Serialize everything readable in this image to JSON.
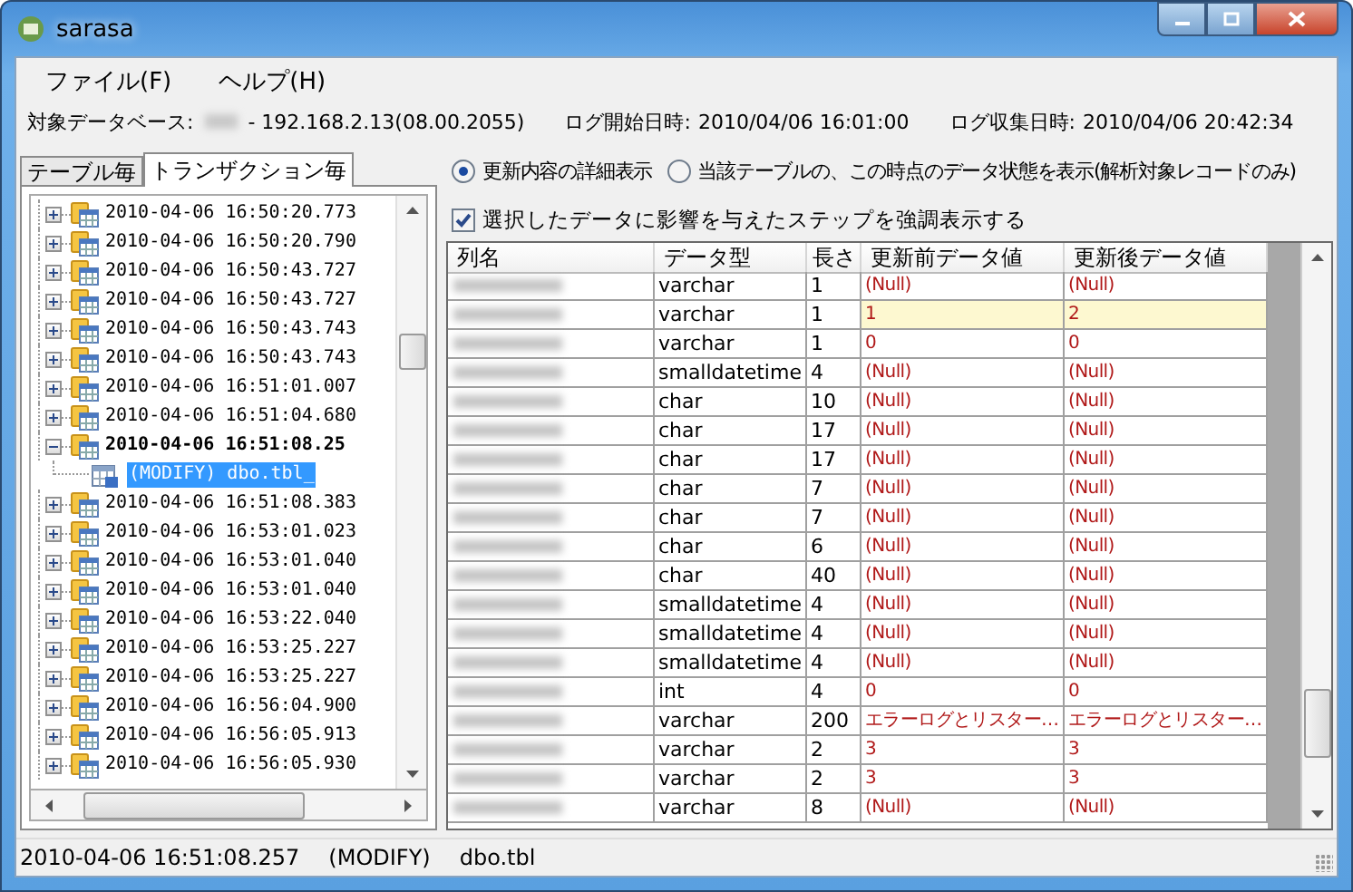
{
  "window": {
    "title": "sarasa"
  },
  "menu": [
    "ファイル(F)",
    "ヘルプ(H)"
  ],
  "info": {
    "db_label": "対象データベース:",
    "db_value": "- 192.168.2.13(08.00.2055)",
    "start_label": "ログ開始日時:",
    "start_value": "2010/04/06 16:01:00",
    "collect_label": "ログ収集日時:",
    "collect_value": "2010/04/06 20:42:34"
  },
  "tabs": [
    {
      "label": "テーブル毎",
      "selected": false
    },
    {
      "label": "トランザクション毎",
      "selected": true
    }
  ],
  "tree": [
    {
      "label": "2010-04-06 16:50:20.773",
      "expanded": false
    },
    {
      "label": "2010-04-06 16:50:20.790",
      "expanded": false
    },
    {
      "label": "2010-04-06 16:50:43.727",
      "expanded": false
    },
    {
      "label": "2010-04-06 16:50:43.727",
      "expanded": false
    },
    {
      "label": "2010-04-06 16:50:43.743",
      "expanded": false
    },
    {
      "label": "2010-04-06 16:50:43.743",
      "expanded": false
    },
    {
      "label": "2010-04-06 16:51:01.007",
      "expanded": false
    },
    {
      "label": "2010-04-06 16:51:04.680",
      "expanded": false
    },
    {
      "label": "2010-04-06 16:51:08.25",
      "expanded": true,
      "children": [
        {
          "label": "(MODIFY)   dbo.tbl_",
          "selected": true
        }
      ]
    },
    {
      "label": "2010-04-06 16:51:08.383",
      "expanded": false
    },
    {
      "label": "2010-04-06 16:53:01.023",
      "expanded": false
    },
    {
      "label": "2010-04-06 16:53:01.040",
      "expanded": false
    },
    {
      "label": "2010-04-06 16:53:01.040",
      "expanded": false
    },
    {
      "label": "2010-04-06 16:53:22.040",
      "expanded": false
    },
    {
      "label": "2010-04-06 16:53:25.227",
      "expanded": false
    },
    {
      "label": "2010-04-06 16:53:25.227",
      "expanded": false
    },
    {
      "label": "2010-04-06 16:56:04.900",
      "expanded": false
    },
    {
      "label": "2010-04-06 16:56:05.913",
      "expanded": false
    },
    {
      "label": "2010-04-06 16:56:05.930",
      "expanded": false
    }
  ],
  "view_options": [
    {
      "label": "更新内容の詳細表示",
      "selected": true
    },
    {
      "label": "当該テーブルの、この時点のデータ状態を表示(解析対象レコードのみ)",
      "selected": false
    }
  ],
  "highlight_option": {
    "label": "選択したデータに影響を与えたステップを強調表示する",
    "checked": true
  },
  "table": {
    "columns": [
      "列名",
      "データ型",
      "長さ",
      "更新前データ値",
      "更新後データ値"
    ],
    "rows": [
      {
        "type": "varchar",
        "length": "1",
        "before": "(Null)",
        "after": "(Null)",
        "highlighted": false
      },
      {
        "type": "varchar",
        "length": "1",
        "before": "1",
        "after": "2",
        "highlighted": true
      },
      {
        "type": "varchar",
        "length": "1",
        "before": "0",
        "after": "0",
        "highlighted": false
      },
      {
        "type": "smalldatetime",
        "length": "4",
        "before": "(Null)",
        "after": "(Null)",
        "highlighted": false
      },
      {
        "type": "char",
        "length": "10",
        "before": "(Null)",
        "after": "(Null)",
        "highlighted": false
      },
      {
        "type": "char",
        "length": "17",
        "before": "(Null)",
        "after": "(Null)",
        "highlighted": false
      },
      {
        "type": "char",
        "length": "17",
        "before": "(Null)",
        "after": "(Null)",
        "highlighted": false
      },
      {
        "type": "char",
        "length": "7",
        "before": "(Null)",
        "after": "(Null)",
        "highlighted": false
      },
      {
        "type": "char",
        "length": "7",
        "before": "(Null)",
        "after": "(Null)",
        "highlighted": false
      },
      {
        "type": "char",
        "length": "6",
        "before": "(Null)",
        "after": "(Null)",
        "highlighted": false
      },
      {
        "type": "char",
        "length": "40",
        "before": "(Null)",
        "after": "(Null)",
        "highlighted": false
      },
      {
        "type": "smalldatetime",
        "length": "4",
        "before": "(Null)",
        "after": "(Null)",
        "highlighted": false
      },
      {
        "type": "smalldatetime",
        "length": "4",
        "before": "(Null)",
        "after": "(Null)",
        "highlighted": false
      },
      {
        "type": "smalldatetime",
        "length": "4",
        "before": "(Null)",
        "after": "(Null)",
        "highlighted": false
      },
      {
        "type": "int",
        "length": "4",
        "before": "0",
        "after": "0",
        "highlighted": false
      },
      {
        "type": "varchar",
        "length": "200",
        "before": "エラーログとリスター…",
        "after": "エラーログとリスター…",
        "highlighted": false
      },
      {
        "type": "varchar",
        "length": "2",
        "before": "3",
        "after": "3",
        "highlighted": false
      },
      {
        "type": "varchar",
        "length": "2",
        "before": "3",
        "after": "3",
        "highlighted": false
      },
      {
        "type": "varchar",
        "length": "8",
        "before": "(Null)",
        "after": "(Null)",
        "highlighted": false
      }
    ]
  },
  "status_bar": [
    "2010-04-06 16:51:08.257",
    "(MODIFY)",
    "dbo.tbl"
  ]
}
